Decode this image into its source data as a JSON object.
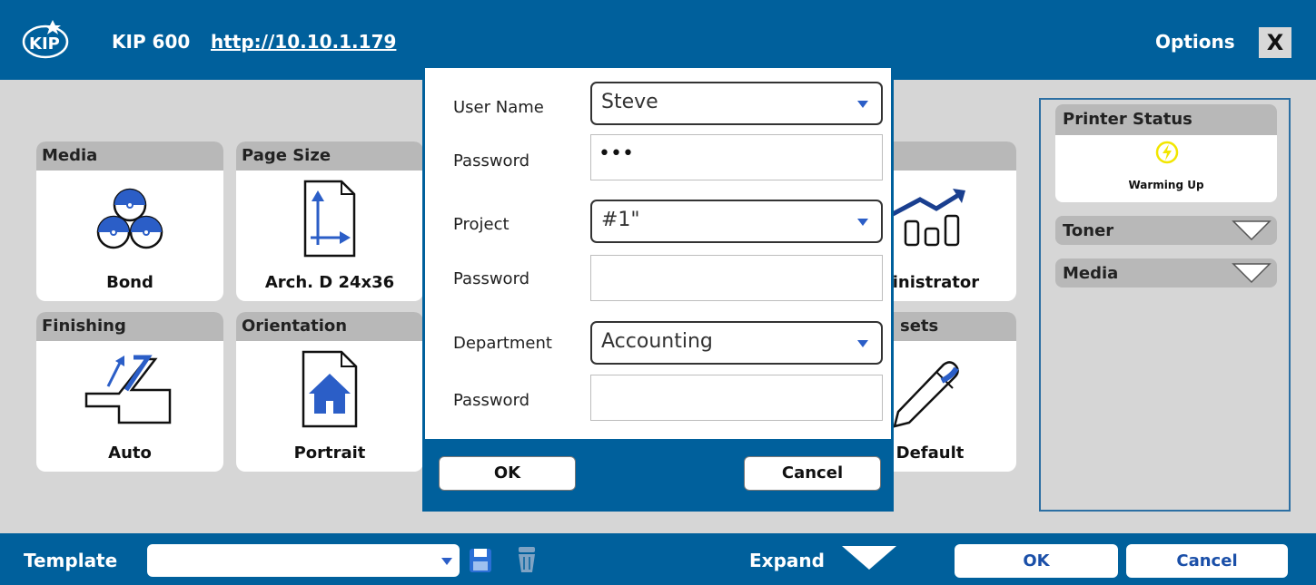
{
  "titlebar": {
    "logo_text": "KIP",
    "title": "KIP 600",
    "url": "http://10.10.1.179",
    "options_label": "Options",
    "close_label": "X"
  },
  "tiles": [
    {
      "header": "Media",
      "value": "Bond",
      "icon": "media-rolls-icon"
    },
    {
      "header": "Page Size",
      "value": "Arch. D 24x36",
      "icon": "page-size-icon"
    },
    {
      "header": "Finishing",
      "value": "Auto",
      "icon": "finishing-fold-icon"
    },
    {
      "header": "Orientation",
      "value": "Portrait",
      "icon": "portrait-house-icon"
    },
    {
      "header": "",
      "value": "ninistrator",
      "icon": "chart-trend-icon"
    },
    {
      "header": "sets",
      "value": "Default",
      "icon": "pen-icon"
    }
  ],
  "printer_status": {
    "title": "Printer Status",
    "state": "Warming Up",
    "state_color": "#f2e600",
    "sections": [
      "Toner",
      "Media"
    ]
  },
  "bottombar": {
    "template_label": "Template",
    "template_value": "",
    "expand_label": "Expand",
    "ok_label": "OK",
    "cancel_label": "Cancel"
  },
  "dialog": {
    "user_name_label": "User Name",
    "user_name_value": "Steve",
    "user_password_label": "Password",
    "user_password_value": "•••",
    "project_label": "Project",
    "project_value": "#1\"",
    "project_password_label": "Password",
    "project_password_value": "",
    "department_label": "Department",
    "department_value": "Accounting",
    "department_password_label": "Password",
    "department_password_value": "",
    "ok_label": "OK",
    "cancel_label": "Cancel"
  },
  "colors": {
    "brand_blue": "#00609c",
    "button_text_blue": "#1a4fa8",
    "icon_blue": "#2b5ec7",
    "panel_gray": "#d6d6d6"
  }
}
